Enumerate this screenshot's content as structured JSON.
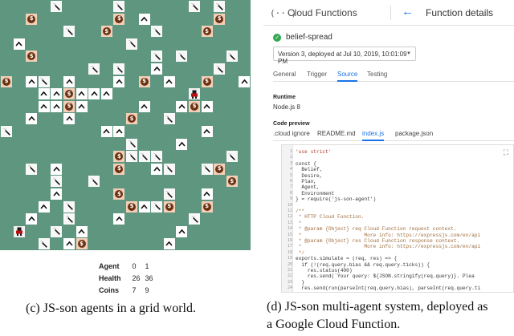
{
  "grid_world": {
    "stats": {
      "rows": [
        {
          "label": "Agent",
          "values": [
            "0",
            "1"
          ]
        },
        {
          "label": "Health",
          "values": [
            "26",
            "36"
          ]
        },
        {
          "label": "Coins",
          "values": [
            "7",
            "9"
          ]
        }
      ]
    },
    "caption": "(c) JS-son agents in a grid world."
  },
  "cloud_function": {
    "logo": "(···)",
    "brand": "Cloud Functions",
    "back_icon": "arrow-left-icon",
    "page_title": "Function details",
    "function_name": "belief-spread",
    "version_label": "Version 3, deployed at Jul 10, 2019, 10:01:09 PM",
    "tabs": [
      "General",
      "Trigger",
      "Source",
      "Testing"
    ],
    "active_tab": "Source",
    "runtime_label": "Runtime",
    "runtime_value": "Node.js 8",
    "preview_label": "Code preview",
    "files": [
      ".cloud ignore",
      "README.md",
      "index.js",
      "package.json"
    ],
    "active_file": "index.js",
    "code_lines": [
      "'use strict'",
      "",
      "const {",
      "  Belief,",
      "  Desire,",
      "  Plan,",
      "  Agent,",
      "  Environment",
      "} = require('js-son-agent')",
      "",
      "/**",
      " * HTTP Cloud Function.",
      " *",
      " * @param {Object} req Cloud Function request context.",
      " *                     More info: https://expressjs.com/en/api",
      " * @param {Object} res Cloud Function response context.",
      " *                     More info: https://expressjs.com/en/api",
      " */",
      "exports.simulate = (req, res) => {",
      "  if (!(req.query.bias && req.query.ticks)) {",
      "    res.status(400)",
      "    res.send(`Your query: ${JSON.stringify(req.query)}. Plea",
      "  }",
      "  res.send(run(parseInt(req.query.bias), parseInt(req.query.ti"
    ],
    "caption_line1": "(d) JS-son multi-agent system, deployed as",
    "caption_line2": "a Google Cloud Function."
  }
}
